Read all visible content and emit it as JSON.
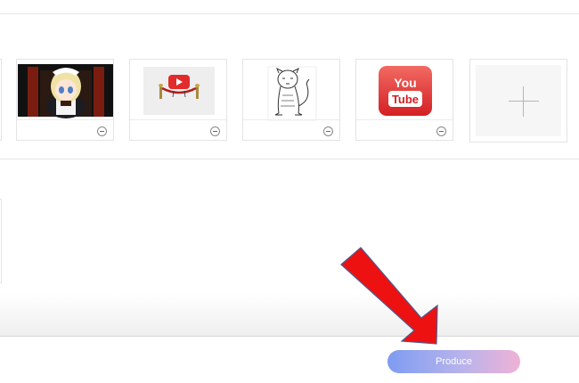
{
  "toolbar": {
    "produce_label": "Produce"
  },
  "thumbnails": {
    "youtube_logo": {
      "line1": "You",
      "line2": "Tube"
    }
  },
  "colors": {
    "button_gradient_start": "#7e9cf1",
    "button_gradient_end": "#efb2d6",
    "annotation_arrow": "#ee1111",
    "youtube_red": "#e8262b"
  },
  "icons": {
    "remove": "minus-circle-icon",
    "add": "plus-icon",
    "annotation": "red-arrow-icon"
  }
}
